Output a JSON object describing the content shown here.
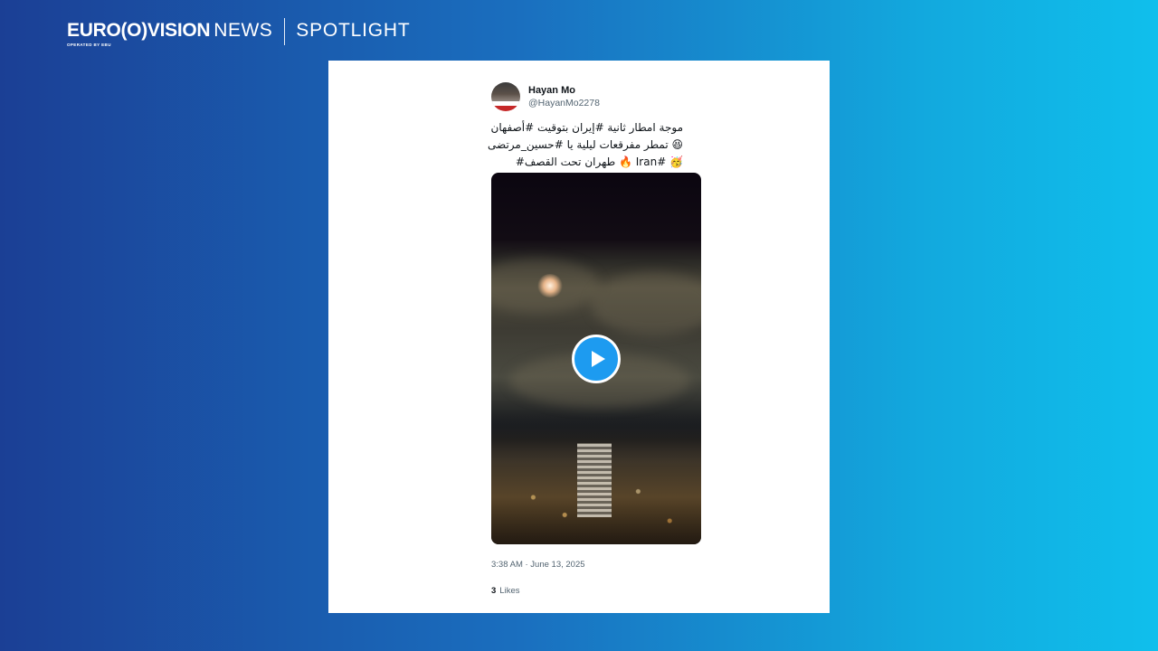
{
  "header": {
    "brand_main": "EURO(O)VISION",
    "brand_news": "NEWS",
    "brand_sub": "OPERATED BY EBU",
    "section": "SPOTLIGHT"
  },
  "tweet": {
    "author_name": "Hayan Mo",
    "author_handle": "@HayanMo2278",
    "text_lines": [
      "موجة امطار ثانية #إيران بتوقيت #أصفهان",
      "😆 تمطر مفرقعات ليلية يا #حسين_مرتضى",
      "🥳 #Iran 🔥 طهران تحت القصف#"
    ],
    "timestamp": "3:38 AM · June 13, 2025",
    "likes_count": "3",
    "likes_label": "Likes"
  },
  "colors": {
    "accent": "#1d9bf0",
    "bg_left": "#1b3f95",
    "bg_right": "#10bfec"
  }
}
